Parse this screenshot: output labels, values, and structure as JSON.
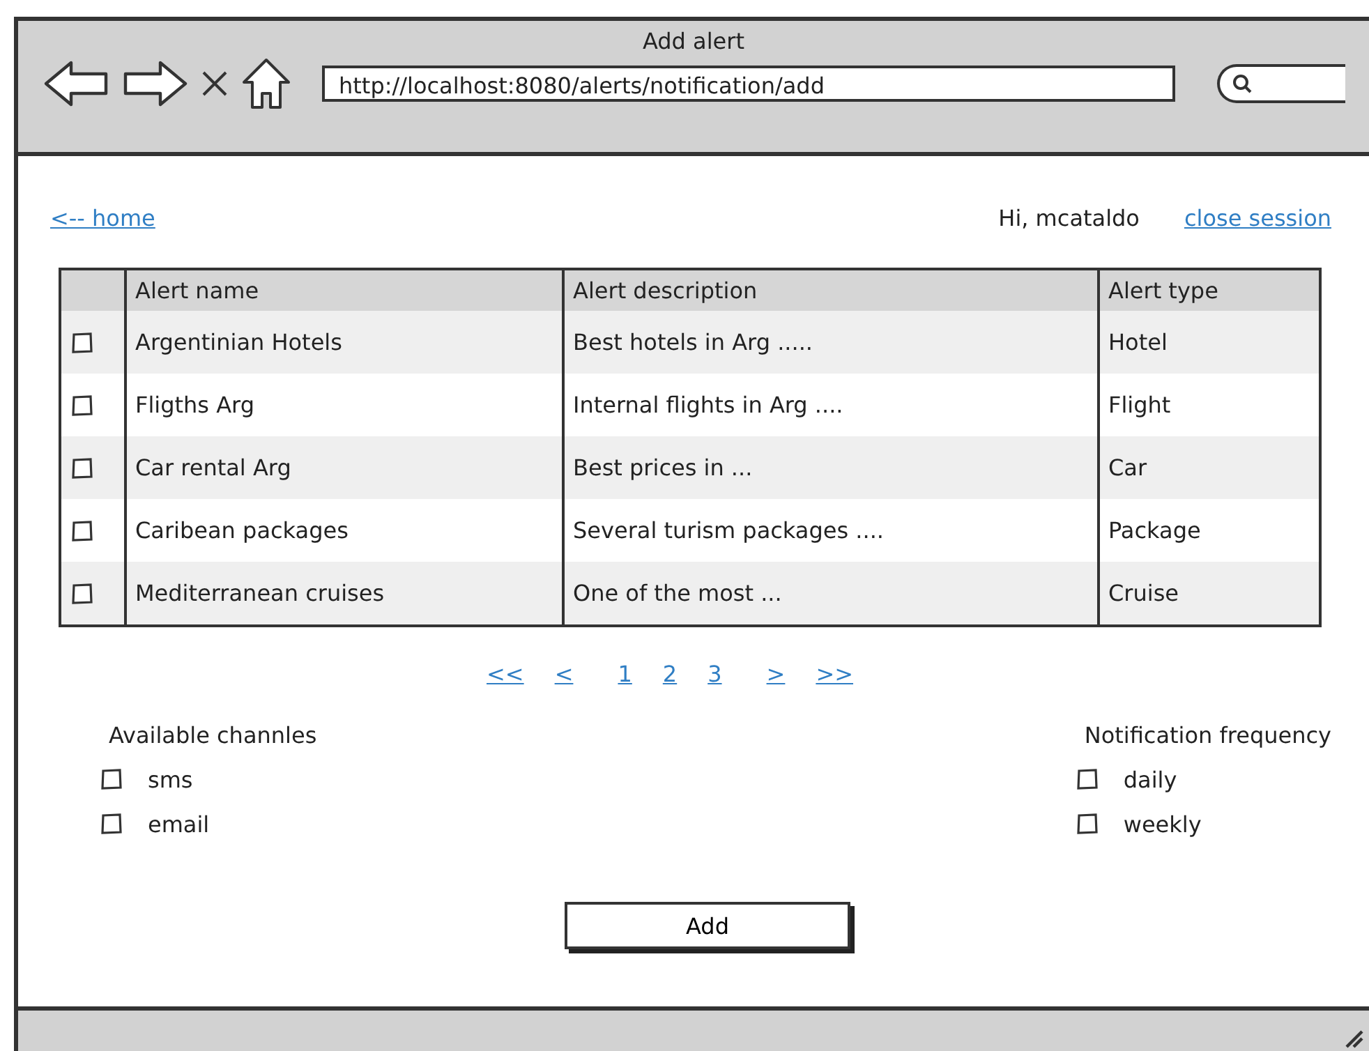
{
  "window": {
    "title": "Add alert"
  },
  "browser": {
    "url": "http://localhost:8080/alerts/notification/add"
  },
  "nav": {
    "home_link": "<-- home",
    "greeting": "Hi, mcataldo",
    "logout_link": "close session"
  },
  "table": {
    "columns": [
      "Alert name",
      "Alert description",
      "Alert type"
    ],
    "rows": [
      {
        "checked": false,
        "cells": [
          "Argentinian Hotels",
          "Best hotels in Arg .....",
          "Hotel"
        ]
      },
      {
        "checked": false,
        "cells": [
          "Fligths Arg",
          "Internal flights in Arg ....",
          "Flight"
        ]
      },
      {
        "checked": false,
        "cells": [
          "Car rental Arg",
          "Best prices in ...",
          "Car"
        ]
      },
      {
        "checked": false,
        "cells": [
          "Caribean packages",
          "Several turism packages ....",
          "Package"
        ]
      },
      {
        "checked": false,
        "cells": [
          "Mediterranean cruises",
          "One of the most ...",
          "Cruise"
        ]
      }
    ]
  },
  "pagination": [
    "<<",
    "<",
    "1",
    "2",
    "3",
    ">",
    ">>"
  ],
  "channels": {
    "title": "Available channles",
    "options": [
      {
        "label": "sms",
        "checked": false
      },
      {
        "label": "email",
        "checked": false
      }
    ]
  },
  "frequency": {
    "title": "Notification frequency",
    "options": [
      {
        "label": "daily",
        "checked": false
      },
      {
        "label": "weekly",
        "checked": false
      }
    ]
  },
  "submit": "Add"
}
